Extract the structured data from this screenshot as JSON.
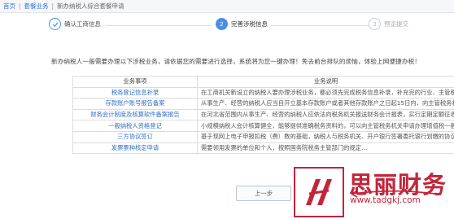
{
  "breadcrumb": {
    "home": "首页",
    "section": "套餐业务",
    "page": "新办纳税人综合套餐申请"
  },
  "steps": [
    {
      "num": "1",
      "label": "确认工商信息",
      "state": "done",
      "icon": "check-icon"
    },
    {
      "num": "2",
      "label": "完善涉税信息",
      "state": "active",
      "icon": "step-number"
    },
    {
      "num": "3",
      "label": "预览提交",
      "state": "todo",
      "icon": "step-number"
    }
  ],
  "intro": "新办纳税人一般需要办理以下涉税业务，请依据您的需要进行选择，系统将为您一键办理！免去前台排队的烦恼，体验上网便捷办税！",
  "table": {
    "headers": [
      "业务事项",
      "业务说明"
    ],
    "rows": [
      [
        "税务登记信息补录",
        "在工商机关新设立的纳税人要办理涉税业务，都必须先完成税务信息补录，补充完的行业、主管税务机关等…"
      ],
      [
        "存款账户账号报告备案",
        "从事生产、经营的纳税人应当自开立基本存款账户或者其他存款账户之日起15日内，向主管税务机关报…"
      ],
      [
        "财务会计制度及核算软件备案报告",
        "在河北省范围内从事生产、经营的纳税人应依法向税务机关报送财务会计报表，实行定期定额征收方式管理…"
      ],
      [
        "一般纳税人资格登记",
        "小规模纳税人会计核算健全，能够提供准确税务资料的，可以向主管税务机关申请办理增值税一般纳税人登记；…"
      ],
      [
        "三方协议签订",
        "基于现网上电子申报扣税（费）数的基础，纳税人与税务机关、开户银行签署委托银行划缴的协议（税款…"
      ],
      [
        "发票票种核定申请",
        "需要领用发票的单位和个人，按照国务院税务主管部门的规定…"
      ]
    ]
  },
  "back_button": "上一步",
  "watermark": {
    "brand": "思丽财务",
    "url": "www.tadgkj.com",
    "color": "#c4243a"
  },
  "colors": {
    "accent": "#4a90e2",
    "link": "#2f7ad8"
  }
}
